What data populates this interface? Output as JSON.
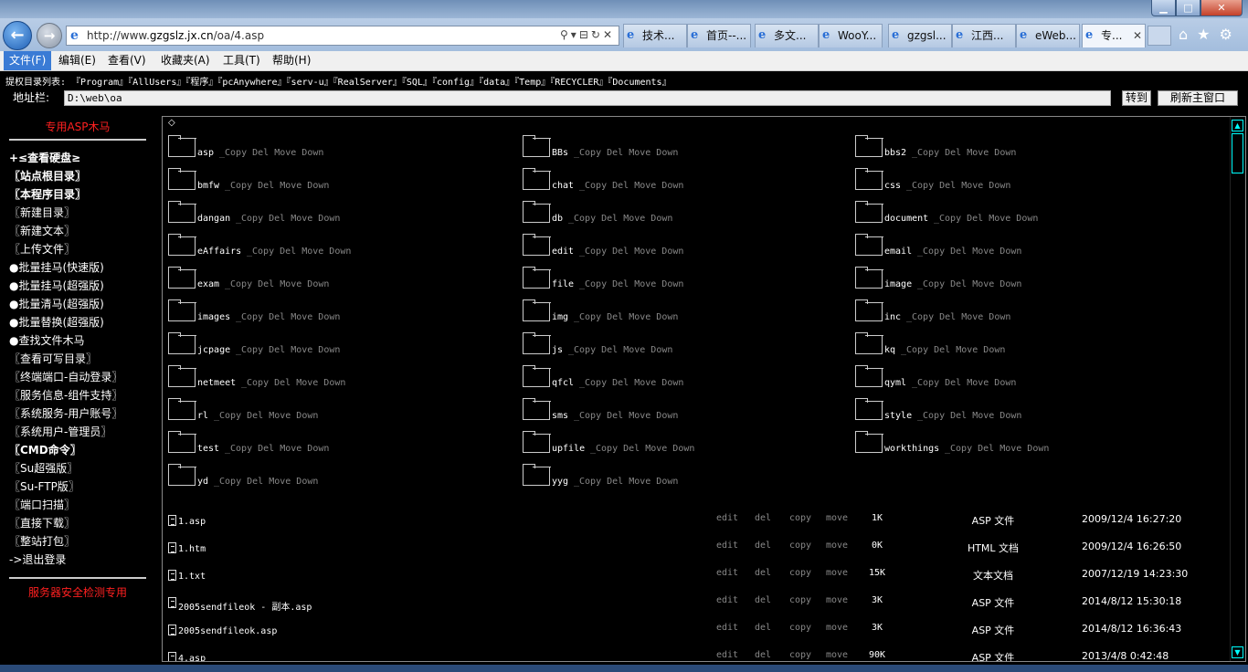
{
  "browser": {
    "url_prefix": "http://www.",
    "url_domain": "gzgslz.jx.cn",
    "url_path": "/oa/4.asp",
    "tabs": [
      "技术...",
      "首页--...",
      "多文...",
      "WooY...",
      "gzgsl...",
      "江西...",
      "eWeb...",
      "专..."
    ],
    "menus": [
      "文件(F)",
      "编辑(E)",
      "查看(V)",
      "收藏夹(A)",
      "工具(T)",
      "帮助(H)"
    ]
  },
  "header": {
    "dirlist": "提权目录列表: 『Program』『AllUsers』『程序』『pcAnywhere』『serv-u』『RealServer』『SQL』『config』『data』『Temp』『RECYCLER』『Documents』",
    "addr_label": "地址栏:",
    "path": "D:\\web\\oa",
    "goto_label": "转到",
    "refresh_label": "刷新主窗口"
  },
  "sidebar": {
    "title": "专用ASP木马",
    "items": [
      "+≤查看硬盘≥",
      "〖站点根目录〗",
      "〖本程序目录〗",
      "〖新建目录〗",
      "〖新建文本〗",
      "〖上传文件〗",
      "●批量挂马(快速版)",
      "●批量挂马(超强版)",
      "●批量清马(超强版)",
      "●批量替换(超强版)",
      "●查找文件木马",
      "〖查看可写目录〗",
      "〖终端端口-自动登录〗",
      "〖服务信息-组件支持〗",
      "〖系统服务-用户账号〗",
      "〖系统用户-管理员〗",
      "〖CMD命令〗",
      "〖Su超强版〗",
      "〖Su-FTP版〗",
      "〖端口扫描〗",
      "〖直接下载〗",
      "〖整站打包〗",
      "->退出登录"
    ],
    "footer": "服务器安全检测专用"
  },
  "main": {
    "top_symbol": "◇",
    "folder_ops": "_Copy Del Move Down",
    "folders": [
      [
        "asp",
        "BBs",
        "bbs2"
      ],
      [
        "bmfw",
        "chat",
        "css"
      ],
      [
        "dangan",
        "db",
        "document"
      ],
      [
        "eAffairs",
        "edit",
        "email"
      ],
      [
        "exam",
        "file",
        "image"
      ],
      [
        "images",
        "img",
        "inc"
      ],
      [
        "jcpage",
        "js",
        "kq"
      ],
      [
        "netmeet",
        "qfcl",
        "qyml"
      ],
      [
        "rl",
        "sms",
        "style"
      ],
      [
        "test",
        "upfile",
        "workthings"
      ],
      [
        "yd",
        "yyg"
      ]
    ],
    "file_ops": [
      "edit",
      "del",
      "copy",
      "move"
    ],
    "files": [
      {
        "name": "1.asp",
        "size": "1K",
        "type": "ASP 文件",
        "date": "2009/12/4 16:27:20"
      },
      {
        "name": "1.htm",
        "size": "0K",
        "type": "HTML 文档",
        "date": "2009/12/4 16:26:50"
      },
      {
        "name": "1.txt",
        "size": "15K",
        "type": "文本文档",
        "date": "2007/12/19 14:23:30"
      },
      {
        "name": "2005sendfileok - 副本.asp",
        "size": "3K",
        "type": "ASP 文件",
        "date": "2014/8/12 15:30:18"
      },
      {
        "name": "2005sendfileok.asp",
        "size": "3K",
        "type": "ASP 文件",
        "date": "2014/8/12 16:36:43"
      },
      {
        "name": "4.asp",
        "size": "90K",
        "type": "ASP 文件",
        "date": "2013/4/8 0:42:48"
      }
    ]
  }
}
